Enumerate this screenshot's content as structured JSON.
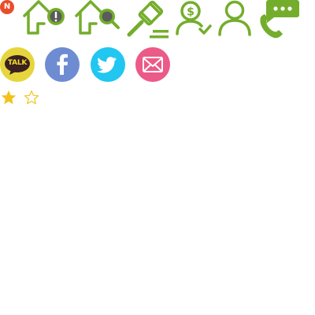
{
  "colors": {
    "green": "#74ad2c",
    "notif_badge": "#e84d2c",
    "kakao": "#e6d63c",
    "kakao_bubble": "#3b2121",
    "facebook": "#6e8cd2",
    "twitter": "#21c6f1",
    "email": "#ec5a87",
    "star": "#f2c21b"
  },
  "notification": {
    "badge_text": "N"
  },
  "top_icons": [
    {
      "name": "home-alert-icon"
    },
    {
      "name": "home-search-icon"
    },
    {
      "name": "auction-gavel-icon"
    },
    {
      "name": "user-dollar-verified-icon"
    },
    {
      "name": "user-icon"
    },
    {
      "name": "phone-chat-icon"
    }
  ],
  "social": {
    "kakao": {
      "label": "TALK",
      "icon": "kakaotalk-icon"
    },
    "facebook": {
      "icon": "facebook-icon"
    },
    "twitter": {
      "icon": "twitter-icon"
    },
    "email": {
      "icon": "email-icon"
    }
  },
  "rating": {
    "filled": 1,
    "total": 2
  }
}
